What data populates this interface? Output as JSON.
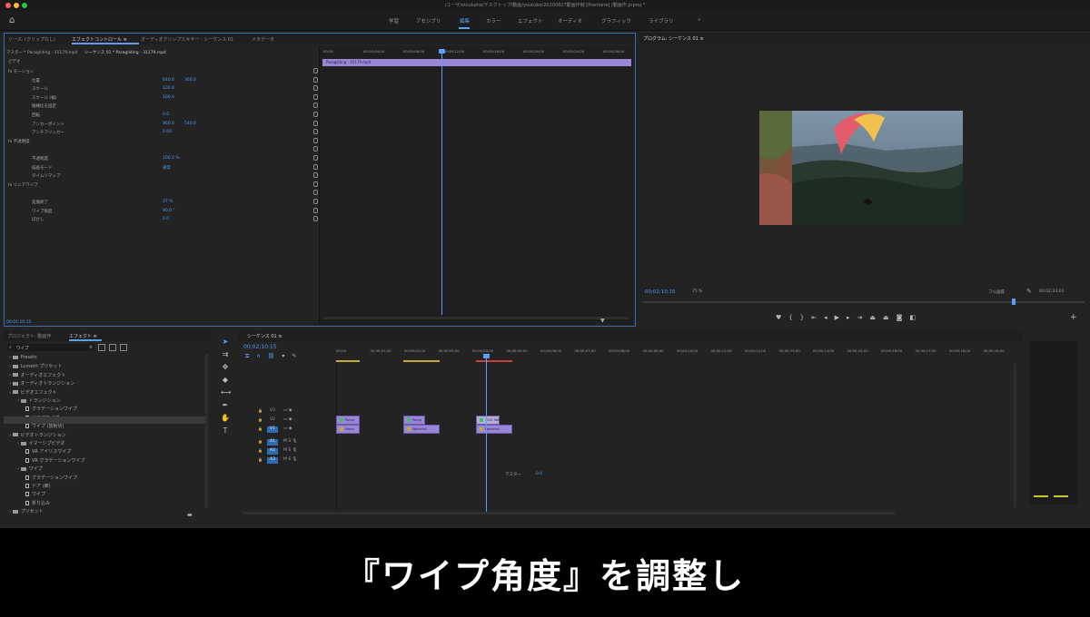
{
  "window": {
    "title": "/ユーザ/otsukaha/デスクトップ/動画/youtube/20200827動画作制 [Premiere] /動画作.prproj *"
  },
  "workspaces": [
    {
      "label": "学習"
    },
    {
      "label": "アセンブリ"
    },
    {
      "label": "編集"
    },
    {
      "label": "カラー"
    },
    {
      "label": "エフェクト"
    },
    {
      "label": "オーディオ"
    },
    {
      "label": "グラフィック"
    },
    {
      "label": "ライブラリ"
    },
    {
      "label": "»"
    }
  ],
  "effect_controls": {
    "tabs": [
      "ソース: (クリップなし)",
      "エフェクトコントロール ≡",
      "オーディオクリップミキサー : シーケンス 01",
      "メタデータ"
    ],
    "master_label": "マスター * Paragliding - 31179.mp4",
    "sequence_label": "シーケンス 01 * Paragliding - 31179.mp4",
    "section_video": "ビデオ",
    "clip_bar_label": "Paragliding - 31179.mp4",
    "ruler": [
      "00;00",
      "00;00;04;04",
      "00;00;08;00",
      "00;00;12;00",
      "00;00;16;00",
      "00;00;20;00",
      "00;00;24;00",
      "00;00;28;00"
    ],
    "rows": [
      {
        "label": "fx モーション",
        "v1": "",
        "v2": ""
      },
      {
        "label": "位置",
        "v1": "640.0",
        "v2": "360.0"
      },
      {
        "label": "スケール",
        "v1": "100.0",
        "v2": ""
      },
      {
        "label": "スケール (幅)",
        "v1": "100.0",
        "v2": ""
      },
      {
        "label": "縦横比を固定",
        "v1": "",
        "v2": ""
      },
      {
        "label": "回転",
        "v1": "0.0",
        "v2": ""
      },
      {
        "label": "アンカーポイント",
        "v1": "960.0",
        "v2": "540.0"
      },
      {
        "label": "アンチフリッカー",
        "v1": "0.00",
        "v2": ""
      },
      {
        "label": "fx 不透明度",
        "v1": "",
        "v2": ""
      },
      {
        "label": "",
        "v1": "",
        "v2": ""
      },
      {
        "label": "不透明度",
        "v1": "100.0 %",
        "v2": ""
      },
      {
        "label": "描画モード",
        "v1": "通常",
        "v2": ""
      },
      {
        "label": "タイムリマップ",
        "v1": "",
        "v2": ""
      },
      {
        "label": "fx リニアワイプ",
        "v1": "",
        "v2": ""
      },
      {
        "label": "",
        "v1": "",
        "v2": ""
      },
      {
        "label": "変換終了",
        "v1": "37 %",
        "v2": ""
      },
      {
        "label": "ワイプ角度",
        "v1": "90.0 °",
        "v2": ""
      },
      {
        "label": "ぼかし",
        "v1": "0.0",
        "v2": ""
      }
    ],
    "timecode": "00;01;10;15"
  },
  "program": {
    "title": "プログラム: シーケンス 01 ≡",
    "timecode": "00;02;10;15",
    "zoom": "75 %",
    "quality": "フル画質",
    "duration": "00;02;33;01"
  },
  "effects_panel": {
    "tabs": [
      "プロジェクト: 動画作",
      "エフェクト ≡"
    ],
    "search": "ワイプ",
    "items": [
      {
        "label": "Presets",
        "indent": 0,
        "kind": "folder"
      },
      {
        "label": "Lumetri プリセット",
        "indent": 0,
        "kind": "folder"
      },
      {
        "label": "オーディオエフェクト",
        "indent": 0,
        "kind": "folder"
      },
      {
        "label": "オーディオトランジション",
        "indent": 0,
        "kind": "folder"
      },
      {
        "label": "ビデオエフェクト",
        "indent": 0,
        "kind": "folder"
      },
      {
        "label": "トランジション",
        "indent": 1,
        "kind": "folder"
      },
      {
        "label": "グラデーションワイプ",
        "indent": 2,
        "kind": "file"
      },
      {
        "label": "リニアワイプ",
        "indent": 2,
        "kind": "file"
      },
      {
        "label": "ワイプ (放射状)",
        "indent": 2,
        "kind": "file"
      },
      {
        "label": "ビデオトランジション",
        "indent": 0,
        "kind": "folder"
      },
      {
        "label": "イマーシブビデオ",
        "indent": 1,
        "kind": "folder"
      },
      {
        "label": "VR アイリスワイプ",
        "indent": 2,
        "kind": "file"
      },
      {
        "label": "VR グラデーションワイプ",
        "indent": 2,
        "kind": "file"
      },
      {
        "label": "ワイプ",
        "indent": 1,
        "kind": "folder"
      },
      {
        "label": "グラデーションワイプ",
        "indent": 2,
        "kind": "file"
      },
      {
        "label": "ドア (扉)",
        "indent": 2,
        "kind": "file"
      },
      {
        "label": "ワイプ",
        "indent": 2,
        "kind": "file"
      },
      {
        "label": "折り込み",
        "indent": 2,
        "kind": "file"
      },
      {
        "label": "プリセット",
        "indent": 0,
        "kind": "folder"
      }
    ]
  },
  "timeline": {
    "title": "シーケンス 01 ≡",
    "timecode": "00;02;10;15",
    "ruler": [
      "00;00",
      "00;00;01;00",
      "00;00;02;00",
      "00;00;03;00",
      "00;00;04;00",
      "00;00;05;00",
      "00;00;06;00",
      "00;00;07;00",
      "00;00;08;00",
      "00;00;09;00",
      "00;00;10;00",
      "00;00;11;00",
      "00;00;12;00",
      "00;00;13;00",
      "00;00;14;00",
      "00;00;15;00",
      "00;00;16;00",
      "00;00;17;00",
      "00;00;18;00",
      "00;00;19;00"
    ],
    "tracks": [
      "V3",
      "V2",
      "V1",
      "A1",
      "A2",
      "A3"
    ],
    "master": "マスター",
    "master_value": "0.0",
    "clips": [
      {
        "label": "Parag",
        "track": "V2",
        "start": 0
      },
      {
        "label": "Parag",
        "track": "V2",
        "start": 1
      },
      {
        "label": "Mana",
        "track": "V1",
        "start": 0
      },
      {
        "label": "Waterfall",
        "track": "V1",
        "start": 1
      },
      {
        "label": "1021 Wat",
        "track": "V2",
        "start": 2
      },
      {
        "label": "Waterfall",
        "track": "V1",
        "start": 2
      }
    ]
  },
  "caption": "『ワイプ角度』を調整し",
  "colors": {
    "accent": "#4f9bf0",
    "clip": "#9a86d6",
    "playhead": "#5ba0f0"
  }
}
